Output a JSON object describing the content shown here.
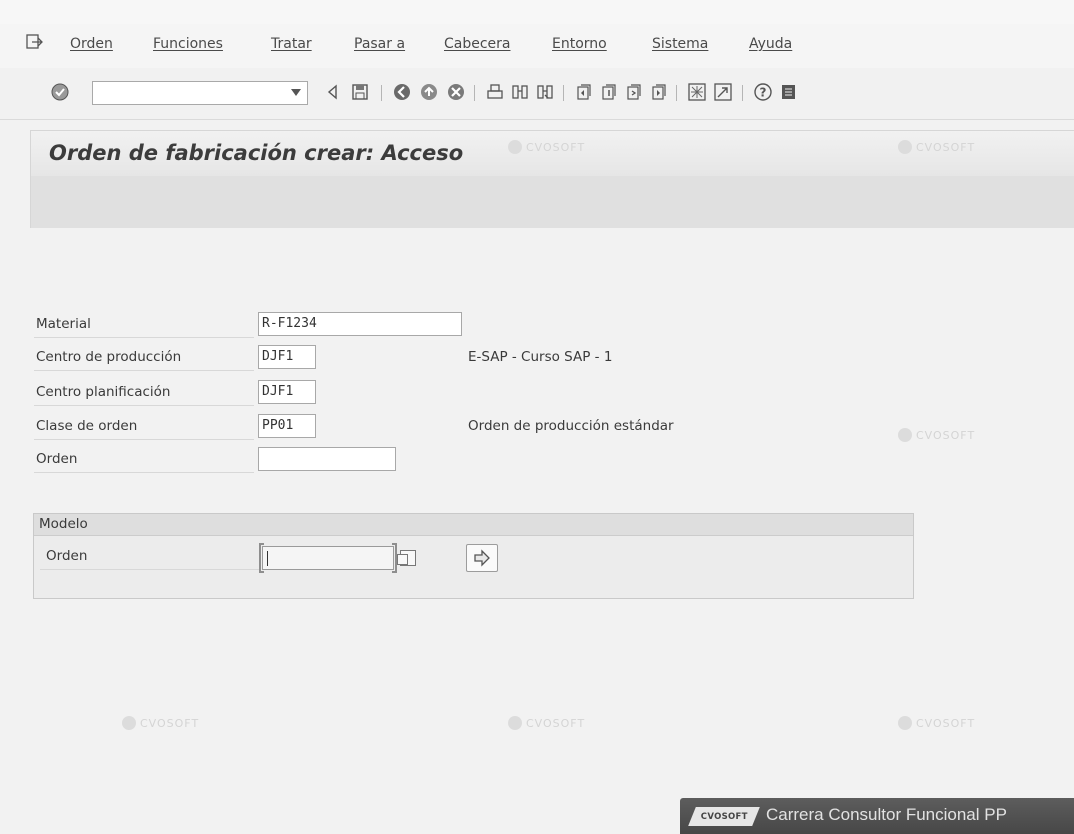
{
  "menu": {
    "items": [
      "Orden",
      "Funciones",
      "Tratar",
      "Pasar a",
      "Cabecera",
      "Entorno",
      "Sistema",
      "Ayuda"
    ]
  },
  "toolbar": {
    "command_value": "",
    "icons": [
      "enter-icon",
      "back-arrow-icon",
      "save-icon",
      "back-icon",
      "exit-icon",
      "cancel-icon",
      "print-icon",
      "find-icon",
      "find-next-icon",
      "first-page-icon",
      "previous-page-icon",
      "next-page-icon",
      "last-page-icon",
      "create-session-icon",
      "shortcut-icon",
      "help-icon",
      "layout-icon"
    ]
  },
  "page": {
    "title": "Orden de fabricación crear: Acceso"
  },
  "form": {
    "material": {
      "label": "Material",
      "value": "R-F1234"
    },
    "plant": {
      "label": "Centro de producción",
      "value": "DJF1",
      "description": "E-SAP - Curso SAP - 1"
    },
    "planning_plant": {
      "label": "Centro planificación",
      "value": "DJF1"
    },
    "order_type": {
      "label": "Clase de orden",
      "value": "PP01",
      "description": "Orden de producción estándar"
    },
    "order": {
      "label": "Orden",
      "value": ""
    }
  },
  "model": {
    "title": "Modelo",
    "order_label": "Orden",
    "order_value": ""
  },
  "banner": {
    "logo": "CVOSOFT",
    "text": "Carrera Consultor Funcional PP"
  },
  "watermark": {
    "text": "CVOSOFT"
  }
}
